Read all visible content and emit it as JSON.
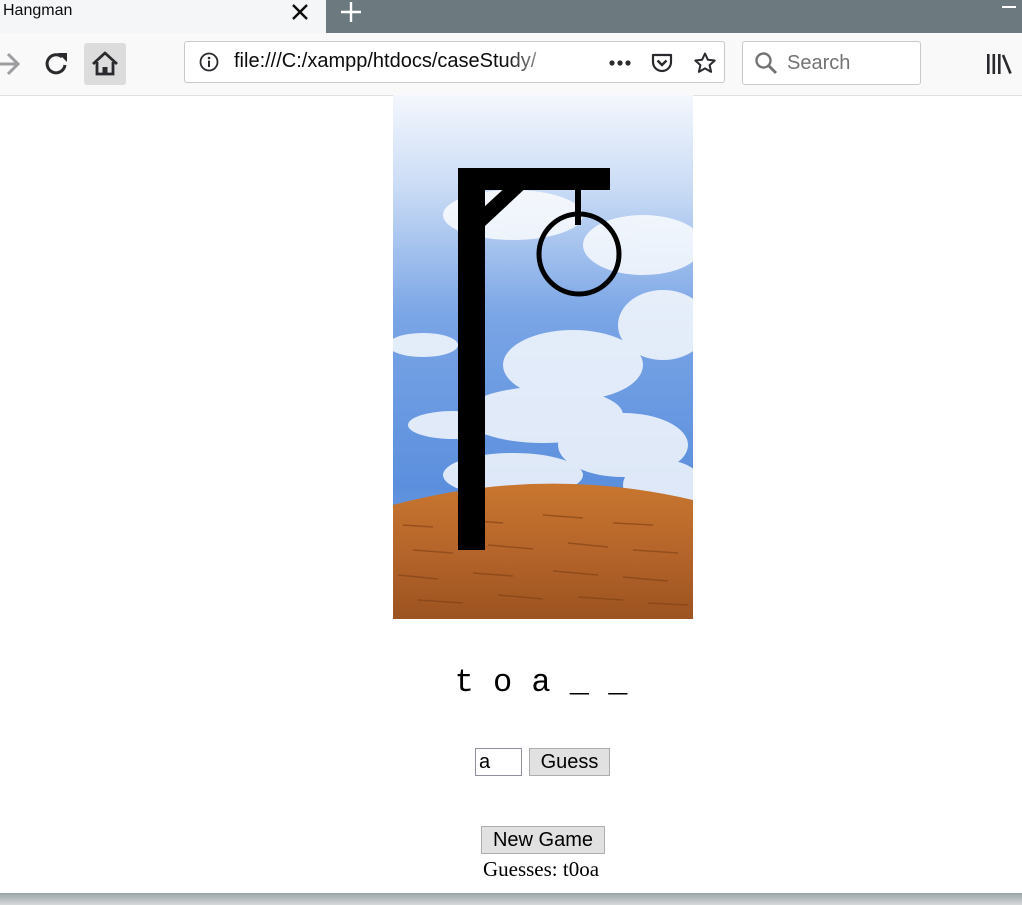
{
  "browser": {
    "tab_title": "Hangman",
    "url": "file:///C:/xampp/htdocs/caseStudy/",
    "search_placeholder": "Search"
  },
  "game": {
    "word_letters": [
      "t",
      "o",
      "a",
      "_",
      "_"
    ],
    "word_display": "t o a _ _",
    "guess_input_value": "a",
    "guess_button_label": "Guess",
    "new_game_label": "New Game",
    "guesses_label": "Guesses:",
    "guesses_value": "t0oa",
    "guesses_line": "Guesses: t0oa"
  },
  "icons": {
    "tab_close": "close-icon",
    "new_tab": "plus-icon",
    "back": "arrow-right-icon",
    "reload": "reload-icon",
    "home": "home-icon",
    "info": "info-icon",
    "more": "more-icon",
    "pocket": "pocket-icon",
    "bookmark": "star-icon",
    "search": "search-icon",
    "library": "library-icon"
  },
  "colors": {
    "tabbar": "#6c7a7f",
    "sky_top": "#eef3fb",
    "sky_blue": "#4f86d9",
    "ground": "#b8682a",
    "gallows": "#000000"
  }
}
